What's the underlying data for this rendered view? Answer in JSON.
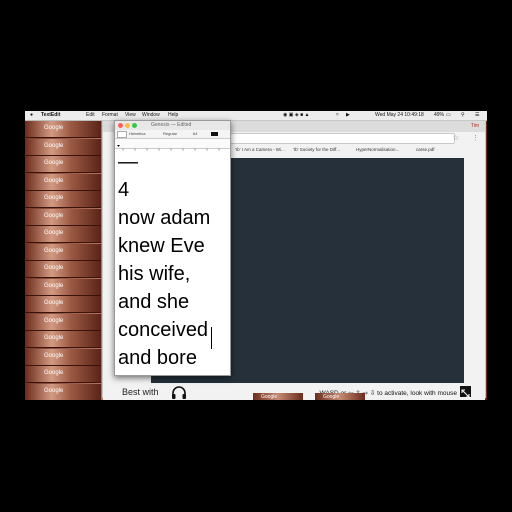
{
  "menubar": {
    "app_name": "TextEdit",
    "menus": [
      "Edit",
      "Format",
      "View",
      "Window",
      "Help"
    ],
    "clock": "Wed May 24  10:49:18",
    "battery": "49%"
  },
  "desktop": {
    "tile_label": "Google"
  },
  "browser": {
    "bookmarks": [
      "'Ib' I Am a Camera - Wi...",
      "'Ib' Society for the Diff...",
      "HyperNormalisation...",
      "carse.pdf"
    ],
    "footer": {
      "best_with": "Best with",
      "instructions": "WASD or ⇦ ⇧ ⇨ ⇩ to activate, look with mouse"
    },
    "profile": "Tim"
  },
  "textedit": {
    "title": "Genesis — Edited",
    "font_name": "Helvetica",
    "font_style": "Regular",
    "font_size": "64",
    "lines": [
      "—",
      "4",
      "now adam",
      "knew Eve",
      "his wife,",
      "and she",
      "conceived",
      "and bore"
    ]
  },
  "colors": {
    "viewport_bg": "#25303a",
    "close": "#fc605c",
    "minimize": "#fdbc40",
    "zoom": "#34c84a"
  },
  "icons": [
    "apple-icon",
    "headphones-icon",
    "fullscreen-icon",
    "wifi-icon",
    "battery-icon",
    "search-icon"
  ]
}
